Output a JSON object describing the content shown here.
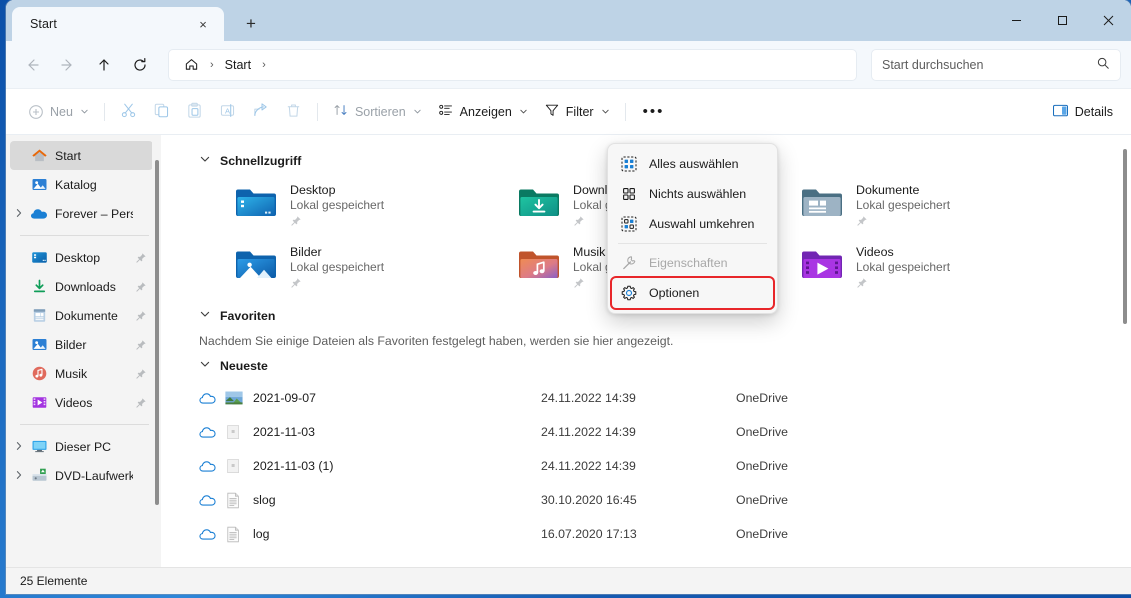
{
  "window": {
    "tabs": [
      {
        "title": "Start",
        "close_label": "×"
      }
    ],
    "new_tab_label": "+",
    "controls": {
      "minimize": "—",
      "maximize": "□",
      "close": "✕"
    }
  },
  "nav": {
    "back": "←",
    "forward": "→",
    "up": "↑",
    "refresh": "⟳",
    "breadcrumb": {
      "home_icon": "home-icon",
      "sep1": "›",
      "crumb": "Start",
      "sep2": "›"
    }
  },
  "search": {
    "placeholder": "Start durchsuchen",
    "value": "Start durchsuchen",
    "icon": "search-icon"
  },
  "toolbar": {
    "new_label": "Neu",
    "cut_label": "Ausschneiden",
    "copy_label": "Kopieren",
    "paste_label": "Einfügen",
    "rename_label": "Umbenennen",
    "share_label": "Freigeben",
    "delete_label": "Löschen",
    "sort_label": "Sortieren",
    "view_label": "Anzeigen",
    "filter_label": "Filter",
    "more_label": "•••",
    "details_label": "Details",
    "chevron": "⌄"
  },
  "sidebar": {
    "items": [
      {
        "label": "Start",
        "icon": "home-icon",
        "selected": true,
        "expandable": false,
        "pinned": false
      },
      {
        "label": "Katalog",
        "icon": "gallery-icon",
        "selected": false,
        "expandable": false,
        "pinned": false
      },
      {
        "label": "Forever – Persör",
        "icon": "onedrive-icon",
        "selected": false,
        "expandable": true,
        "pinned": false
      },
      {
        "divider": true
      },
      {
        "label": "Desktop",
        "icon": "desktop-icon",
        "selected": false,
        "expandable": false,
        "pinned": true
      },
      {
        "label": "Downloads",
        "icon": "downloads-icon",
        "selected": false,
        "expandable": false,
        "pinned": true
      },
      {
        "label": "Dokumente",
        "icon": "documents-icon",
        "selected": false,
        "expandable": false,
        "pinned": true
      },
      {
        "label": "Bilder",
        "icon": "pictures-icon",
        "selected": false,
        "expandable": false,
        "pinned": true
      },
      {
        "label": "Musik",
        "icon": "music-icon",
        "selected": false,
        "expandable": false,
        "pinned": true
      },
      {
        "label": "Videos",
        "icon": "videos-icon",
        "selected": false,
        "expandable": false,
        "pinned": true
      },
      {
        "divider": true
      },
      {
        "label": "Dieser PC",
        "icon": "this-pc-icon",
        "selected": false,
        "expandable": true,
        "pinned": false
      },
      {
        "label": "DVD-Laufwerk (",
        "icon": "dvd-drive-icon",
        "selected": false,
        "expandable": true,
        "pinned": false
      }
    ]
  },
  "content": {
    "quick_access": {
      "title": "Schnellzugriff",
      "chevron": "⌄",
      "items": [
        {
          "name": "Desktop",
          "sub": "Lokal gespeichert",
          "icon": "folder-desktop-icon",
          "pinned": true
        },
        {
          "name": "Downloads",
          "sub": "Lokal gespeichert",
          "icon": "folder-downloads-icon",
          "pinned": true
        },
        {
          "name": "Dokumente",
          "sub": "Lokal gespeichert",
          "icon": "folder-documents-icon",
          "pinned": true
        },
        {
          "name": "Bilder",
          "sub": "Lokal gespeichert",
          "icon": "folder-pictures-icon",
          "pinned": true
        },
        {
          "name": "Musik",
          "sub": "Lokal gespeichert",
          "icon": "folder-music-icon",
          "pinned": true
        },
        {
          "name": "Videos",
          "sub": "Lokal gespeichert",
          "icon": "folder-videos-icon",
          "pinned": true
        }
      ]
    },
    "favorites": {
      "title": "Favoriten",
      "chevron": "⌄",
      "empty_text": "Nachdem Sie einige Dateien als Favoriten festgelegt haben, werden sie hier angezeigt."
    },
    "recent": {
      "title": "Neueste",
      "chevron": "⌄",
      "rows": [
        {
          "name": "2021-09-07",
          "date": "24.11.2022 14:39",
          "source": "OneDrive",
          "file_icon": "image-file-icon",
          "status_icon": "cloud-icon"
        },
        {
          "name": "2021-11-03",
          "date": "24.11.2022 14:39",
          "source": "OneDrive",
          "file_icon": "generic-file-icon",
          "status_icon": "cloud-icon"
        },
        {
          "name": "2021-11-03 (1)",
          "date": "24.11.2022 14:39",
          "source": "OneDrive",
          "file_icon": "generic-file-icon",
          "status_icon": "cloud-icon"
        },
        {
          "name": "slog",
          "date": "30.10.2020 16:45",
          "source": "OneDrive",
          "file_icon": "text-file-icon",
          "status_icon": "cloud-icon"
        },
        {
          "name": "log",
          "date": "16.07.2020 17:13",
          "source": "OneDrive",
          "file_icon": "text-file-icon",
          "status_icon": "cloud-icon"
        }
      ]
    }
  },
  "context_menu": {
    "items": [
      {
        "label": "Alles auswählen",
        "icon": "select-all-icon",
        "disabled": false,
        "highlighted": false
      },
      {
        "label": "Nichts auswählen",
        "icon": "select-none-icon",
        "disabled": false,
        "highlighted": false
      },
      {
        "label": "Auswahl umkehren",
        "icon": "invert-selection-icon",
        "disabled": false,
        "highlighted": false
      },
      {
        "divider": true
      },
      {
        "label": "Eigenschaften",
        "icon": "wrench-icon",
        "disabled": true,
        "highlighted": false
      },
      {
        "label": "Optionen",
        "icon": "gear-icon",
        "disabled": false,
        "highlighted": true
      }
    ]
  },
  "statusbar": {
    "text": "25 Elemente"
  },
  "colors": {
    "titlebar": "#bed3e6",
    "navbar": "#f4f8fc",
    "sidebar": "#f4f4f4",
    "selection": "#d9d9d9",
    "accent": "#0f6cbd",
    "highlight_outline": "#e8262a"
  }
}
